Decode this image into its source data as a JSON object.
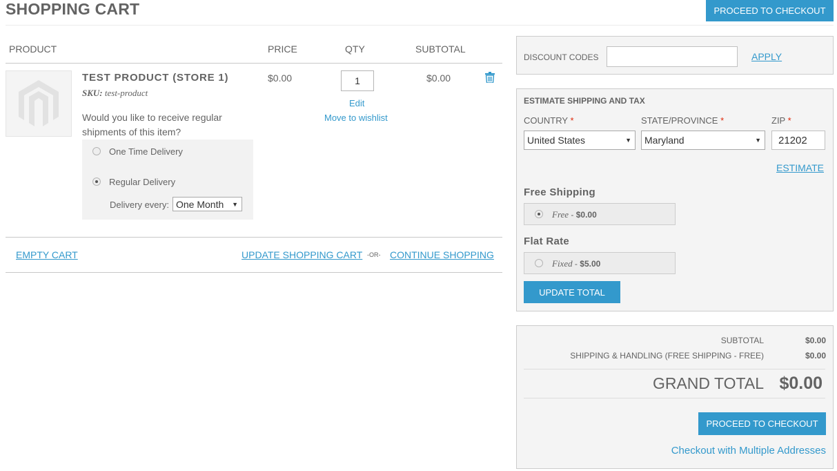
{
  "header": {
    "title": "SHOPPING CART",
    "checkout_label": "PROCEED TO CHECKOUT"
  },
  "table": {
    "columns": [
      "PRODUCT",
      "PRICE",
      "QTY",
      "SUBTOTAL"
    ]
  },
  "item": {
    "name": "TEST PRODUCT (STORE 1)",
    "sku_label": "SKU:",
    "sku_value": "test-product",
    "price": "$0.00",
    "qty": "1",
    "subtotal": "$0.00",
    "edit_label": "Edit",
    "wishlist_label": "Move to wishlist",
    "recurring_question": "Would you like to receive regular shipments of this item?",
    "option_one_time": "One Time Delivery",
    "option_regular": "Regular Delivery",
    "selected_option": "Regular Delivery",
    "delivery_every_label": "Delivery every:",
    "delivery_every_value": "One Month"
  },
  "actions": {
    "empty_cart": "EMPTY CART",
    "update_cart": "UPDATE SHOPPING CART",
    "or": "-OR-",
    "continue_shopping": "CONTINUE SHOPPING"
  },
  "discount": {
    "label": "DISCOUNT CODES",
    "value": "",
    "apply_label": "APPLY"
  },
  "estimate": {
    "title": "ESTIMATE SHIPPING AND TAX",
    "country_label": "COUNTRY",
    "country_value": "United States",
    "state_label": "STATE/PROVINCE",
    "state_value": "Maryland",
    "zip_label": "ZIP",
    "zip_value": "21202",
    "required_mark": "*",
    "estimate_label": "ESTIMATE",
    "free_title": "Free Shipping",
    "free_method": "Free",
    "free_price": "$0.00",
    "flat_title": "Flat Rate",
    "flat_method": "Fixed",
    "flat_price": "$5.00",
    "selected_rate": "Free",
    "update_total_label": "UPDATE TOTAL"
  },
  "totals": {
    "subtotal_label": "SUBTOTAL",
    "subtotal_value": "$0.00",
    "shipping_label": "SHIPPING & HANDLING (FREE SHIPPING - FREE)",
    "shipping_value": "$0.00",
    "grand_label": "GRAND TOTAL",
    "grand_value": "$0.00",
    "checkout_label": "PROCEED TO CHECKOUT",
    "multi_label": "Checkout with Multiple Addresses"
  },
  "colors": {
    "accent": "#3399cc",
    "text": "#636363",
    "required": "#df280a"
  }
}
